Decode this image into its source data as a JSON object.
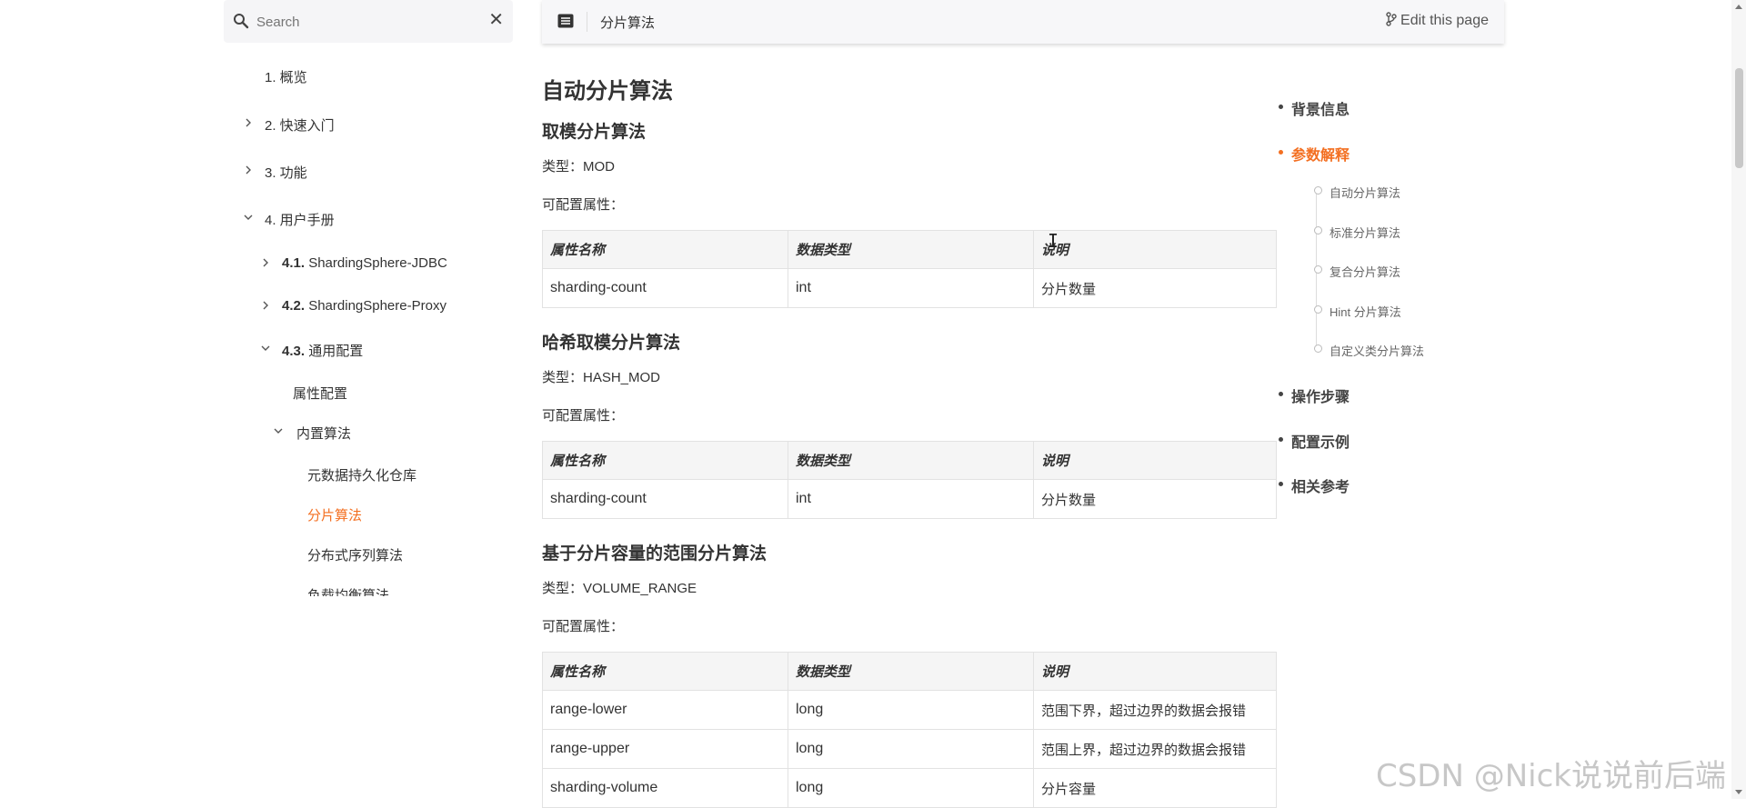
{
  "search": {
    "placeholder": "Search",
    "clear_icon": "close-icon"
  },
  "sidebar": {
    "items": [
      {
        "label": "1. 概览"
      },
      {
        "label": "2. 快速入门"
      },
      {
        "label": "3. 功能"
      },
      {
        "label": "4. 用户手册"
      },
      {
        "num": "4.1.",
        "label": "ShardingSphere-JDBC"
      },
      {
        "num": "4.2.",
        "label": "ShardingSphere-Proxy"
      },
      {
        "num": "4.3.",
        "label": "通用配置"
      },
      {
        "label": "属性配置"
      },
      {
        "label": "内置算法"
      },
      {
        "label": "元数据持久化仓库"
      },
      {
        "label": "分片算法",
        "active": true
      },
      {
        "label": "分布式序列算法"
      },
      {
        "label": "负载均衡算法"
      }
    ]
  },
  "topbar": {
    "breadcrumb": "分片算法",
    "edit_label": "Edit this page"
  },
  "content": {
    "title": "自动分片算法",
    "headers": [
      "属性名称",
      "数据类型",
      "说明"
    ],
    "sections": [
      {
        "title": "取模分片算法",
        "type_line": "类型：MOD",
        "props_line": "可配置属性：",
        "rows": [
          [
            "sharding-count",
            "int",
            "分片数量"
          ]
        ]
      },
      {
        "title": "哈希取模分片算法",
        "type_line": "类型：HASH_MOD",
        "props_line": "可配置属性：",
        "rows": [
          [
            "sharding-count",
            "int",
            "分片数量"
          ]
        ]
      },
      {
        "title": "基于分片容量的范围分片算法",
        "type_line": "类型：VOLUME_RANGE",
        "props_line": "可配置属性：",
        "rows": [
          [
            "range-lower",
            "long",
            "范围下界，超过边界的数据会报错"
          ],
          [
            "range-upper",
            "long",
            "范围上界，超过边界的数据会报错"
          ],
          [
            "sharding-volume",
            "long",
            "分片容量"
          ]
        ]
      }
    ]
  },
  "toc": {
    "items": [
      {
        "label": "背景信息"
      },
      {
        "label": "参数解释",
        "active": true
      },
      {
        "label": "操作步骤"
      },
      {
        "label": "配置示例"
      },
      {
        "label": "相关参考"
      }
    ],
    "sub_items": [
      "自动分片算法",
      "标准分片算法",
      "复合分片算法",
      "Hint 分片算法",
      "自定义类分片算法"
    ]
  },
  "colors": {
    "accent": "#f36f21",
    "text": "#333333",
    "table_header_bg": "#f5f5f5"
  },
  "watermark": "CSDN @Nick说说前后端"
}
